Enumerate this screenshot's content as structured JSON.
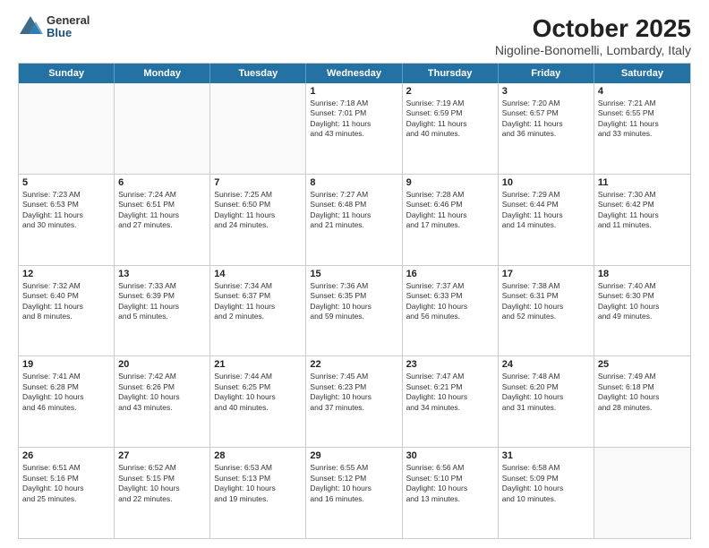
{
  "logo": {
    "general": "General",
    "blue": "Blue"
  },
  "title": "October 2025",
  "subtitle": "Nigoline-Bonomelli, Lombardy, Italy",
  "headers": [
    "Sunday",
    "Monday",
    "Tuesday",
    "Wednesday",
    "Thursday",
    "Friday",
    "Saturday"
  ],
  "rows": [
    [
      {
        "day": "",
        "info": ""
      },
      {
        "day": "",
        "info": ""
      },
      {
        "day": "",
        "info": ""
      },
      {
        "day": "1",
        "info": "Sunrise: 7:18 AM\nSunset: 7:01 PM\nDaylight: 11 hours\nand 43 minutes."
      },
      {
        "day": "2",
        "info": "Sunrise: 7:19 AM\nSunset: 6:59 PM\nDaylight: 11 hours\nand 40 minutes."
      },
      {
        "day": "3",
        "info": "Sunrise: 7:20 AM\nSunset: 6:57 PM\nDaylight: 11 hours\nand 36 minutes."
      },
      {
        "day": "4",
        "info": "Sunrise: 7:21 AM\nSunset: 6:55 PM\nDaylight: 11 hours\nand 33 minutes."
      }
    ],
    [
      {
        "day": "5",
        "info": "Sunrise: 7:23 AM\nSunset: 6:53 PM\nDaylight: 11 hours\nand 30 minutes."
      },
      {
        "day": "6",
        "info": "Sunrise: 7:24 AM\nSunset: 6:51 PM\nDaylight: 11 hours\nand 27 minutes."
      },
      {
        "day": "7",
        "info": "Sunrise: 7:25 AM\nSunset: 6:50 PM\nDaylight: 11 hours\nand 24 minutes."
      },
      {
        "day": "8",
        "info": "Sunrise: 7:27 AM\nSunset: 6:48 PM\nDaylight: 11 hours\nand 21 minutes."
      },
      {
        "day": "9",
        "info": "Sunrise: 7:28 AM\nSunset: 6:46 PM\nDaylight: 11 hours\nand 17 minutes."
      },
      {
        "day": "10",
        "info": "Sunrise: 7:29 AM\nSunset: 6:44 PM\nDaylight: 11 hours\nand 14 minutes."
      },
      {
        "day": "11",
        "info": "Sunrise: 7:30 AM\nSunset: 6:42 PM\nDaylight: 11 hours\nand 11 minutes."
      }
    ],
    [
      {
        "day": "12",
        "info": "Sunrise: 7:32 AM\nSunset: 6:40 PM\nDaylight: 11 hours\nand 8 minutes."
      },
      {
        "day": "13",
        "info": "Sunrise: 7:33 AM\nSunset: 6:39 PM\nDaylight: 11 hours\nand 5 minutes."
      },
      {
        "day": "14",
        "info": "Sunrise: 7:34 AM\nSunset: 6:37 PM\nDaylight: 11 hours\nand 2 minutes."
      },
      {
        "day": "15",
        "info": "Sunrise: 7:36 AM\nSunset: 6:35 PM\nDaylight: 10 hours\nand 59 minutes."
      },
      {
        "day": "16",
        "info": "Sunrise: 7:37 AM\nSunset: 6:33 PM\nDaylight: 10 hours\nand 56 minutes."
      },
      {
        "day": "17",
        "info": "Sunrise: 7:38 AM\nSunset: 6:31 PM\nDaylight: 10 hours\nand 52 minutes."
      },
      {
        "day": "18",
        "info": "Sunrise: 7:40 AM\nSunset: 6:30 PM\nDaylight: 10 hours\nand 49 minutes."
      }
    ],
    [
      {
        "day": "19",
        "info": "Sunrise: 7:41 AM\nSunset: 6:28 PM\nDaylight: 10 hours\nand 46 minutes."
      },
      {
        "day": "20",
        "info": "Sunrise: 7:42 AM\nSunset: 6:26 PM\nDaylight: 10 hours\nand 43 minutes."
      },
      {
        "day": "21",
        "info": "Sunrise: 7:44 AM\nSunset: 6:25 PM\nDaylight: 10 hours\nand 40 minutes."
      },
      {
        "day": "22",
        "info": "Sunrise: 7:45 AM\nSunset: 6:23 PM\nDaylight: 10 hours\nand 37 minutes."
      },
      {
        "day": "23",
        "info": "Sunrise: 7:47 AM\nSunset: 6:21 PM\nDaylight: 10 hours\nand 34 minutes."
      },
      {
        "day": "24",
        "info": "Sunrise: 7:48 AM\nSunset: 6:20 PM\nDaylight: 10 hours\nand 31 minutes."
      },
      {
        "day": "25",
        "info": "Sunrise: 7:49 AM\nSunset: 6:18 PM\nDaylight: 10 hours\nand 28 minutes."
      }
    ],
    [
      {
        "day": "26",
        "info": "Sunrise: 6:51 AM\nSunset: 5:16 PM\nDaylight: 10 hours\nand 25 minutes."
      },
      {
        "day": "27",
        "info": "Sunrise: 6:52 AM\nSunset: 5:15 PM\nDaylight: 10 hours\nand 22 minutes."
      },
      {
        "day": "28",
        "info": "Sunrise: 6:53 AM\nSunset: 5:13 PM\nDaylight: 10 hours\nand 19 minutes."
      },
      {
        "day": "29",
        "info": "Sunrise: 6:55 AM\nSunset: 5:12 PM\nDaylight: 10 hours\nand 16 minutes."
      },
      {
        "day": "30",
        "info": "Sunrise: 6:56 AM\nSunset: 5:10 PM\nDaylight: 10 hours\nand 13 minutes."
      },
      {
        "day": "31",
        "info": "Sunrise: 6:58 AM\nSunset: 5:09 PM\nDaylight: 10 hours\nand 10 minutes."
      },
      {
        "day": "",
        "info": ""
      }
    ]
  ]
}
